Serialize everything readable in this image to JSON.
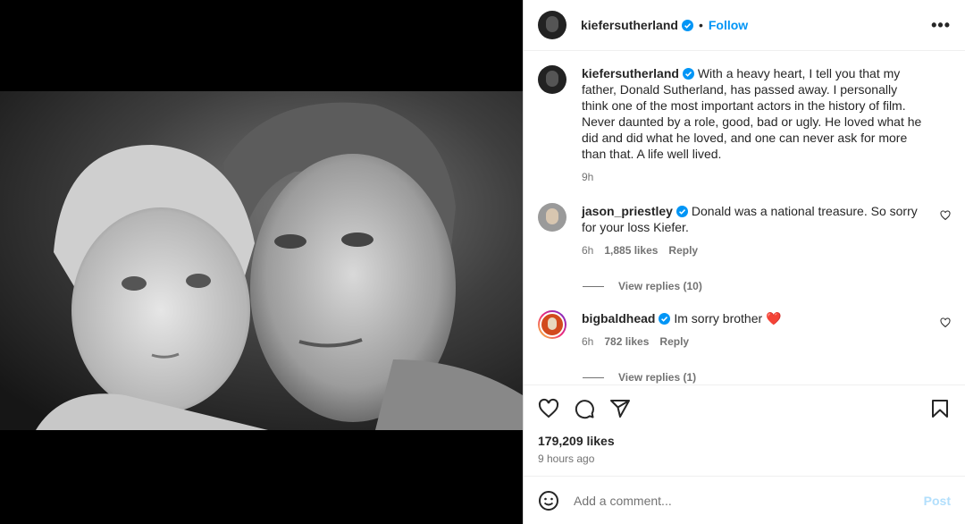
{
  "post": {
    "author": "kiefersutherland",
    "follow_label": "Follow",
    "more_icon": "more-options-icon",
    "separator": "•"
  },
  "caption": {
    "author": "kiefersutherland",
    "text": "With a heavy heart, I tell you that my father, Donald Sutherland, has passed away. I personally think one of the most important actors in the history of film. Never daunted by a role, good, bad or ugly. He loved what he did and did what he loved, and one can never ask for more than that. A life well lived.",
    "time": "9h"
  },
  "comments": [
    {
      "author": "jason_priestley",
      "text": "Donald was a national treasure. So sorry for your loss Kiefer.",
      "time": "6h",
      "likes": "1,885 likes",
      "reply_label": "Reply",
      "view_replies": "View replies (10)"
    },
    {
      "author": "bigbaldhead",
      "text": "Im sorry brother",
      "emoji": "❤️",
      "time": "6h",
      "likes": "782 likes",
      "reply_label": "Reply",
      "view_replies": "View replies (1)"
    }
  ],
  "stats": {
    "likes": "179,209 likes",
    "time_ago": "9 hours ago"
  },
  "composer": {
    "placeholder": "Add a comment...",
    "post_label": "Post"
  },
  "colors": {
    "accent": "#0095f6",
    "verified": "#0095f6",
    "heart": "#ff3040"
  }
}
